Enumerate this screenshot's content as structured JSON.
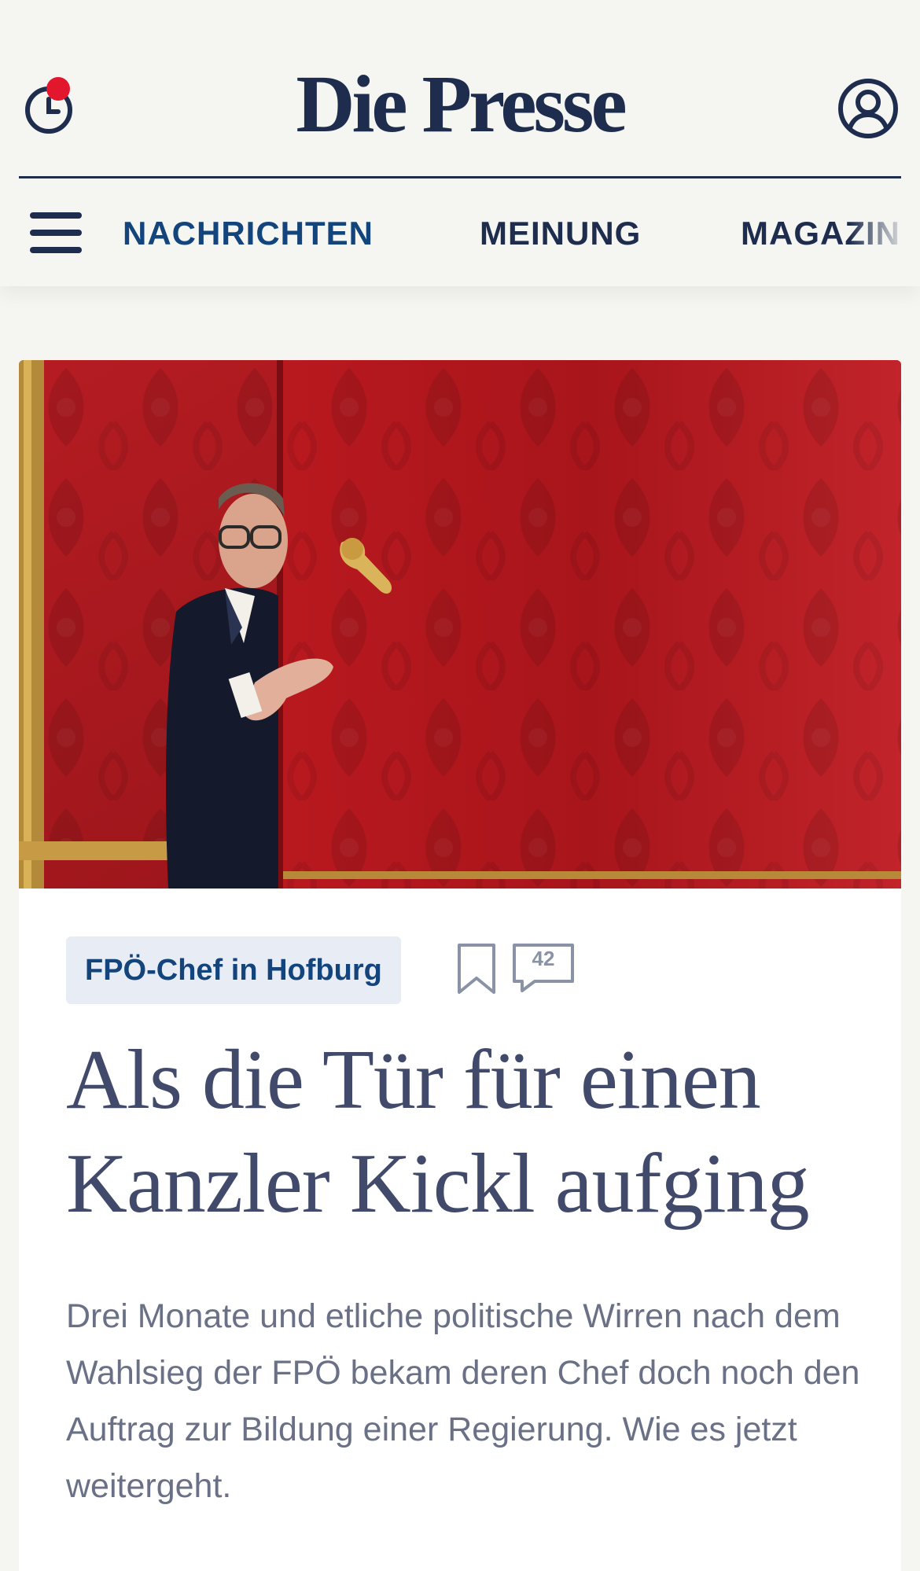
{
  "header": {
    "logo": "Die Presse",
    "history_icon": "clock-history-icon",
    "account_icon": "user-account-icon",
    "notification_color": "#e2162d"
  },
  "nav": {
    "menu_icon": "hamburger-menu-icon",
    "items": [
      {
        "label": "NACHRICHTEN",
        "active": true
      },
      {
        "label": "MEINUNG",
        "active": false
      },
      {
        "label": "MAGAZIN",
        "active": false
      }
    ]
  },
  "article": {
    "tag": "FPÖ-Chef in Hofburg",
    "comment_count": "42",
    "headline": "Als die Tür für einen Kanzler Kickl aufging",
    "lead": "Drei Monate und etliche politische Wirren nach dem Wahlsieg der FPÖ bekam deren Chef doch noch den Auftrag zur Bildung einer Regierung. Wie es jetzt weitergeht."
  },
  "colors": {
    "brand_navy": "#1e2d4e",
    "link_blue": "#13447c",
    "tag_bg": "#e8edf5",
    "headline": "#414a6b",
    "lead": "#6a7186"
  }
}
